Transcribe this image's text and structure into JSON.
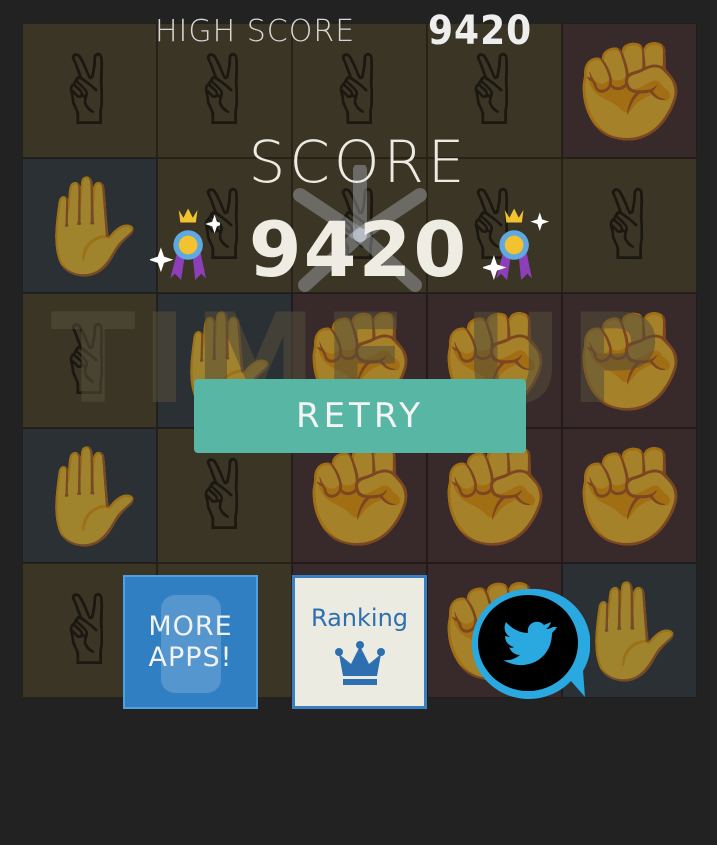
{
  "header": {
    "high_score_label": "HIGH SCORE",
    "high_score_value": "9420"
  },
  "result": {
    "score_label": "SCORE",
    "score_value": "9420",
    "time_up_label": "TIME UP"
  },
  "buttons": {
    "retry_label": "RETRY",
    "more_apps_line1": "MORE",
    "more_apps_line2": "APPS!",
    "ranking_label": "Ranking",
    "twitter_icon": "twitter-bird-icon"
  },
  "board": {
    "rows": [
      [
        "scissors",
        "scissors",
        "scissors",
        "scissors",
        "rock"
      ],
      [
        "paper",
        "scissors",
        "scissors",
        "scissors",
        "scissors"
      ],
      [
        "scissors",
        "paper",
        "rock",
        "rock",
        "rock"
      ],
      [
        "paper",
        "scissors",
        "rock",
        "rock",
        "rock"
      ],
      [
        "scissors",
        "scissors",
        "rock",
        "rock",
        "paper"
      ]
    ]
  },
  "colors": {
    "background": "#222222",
    "retry": "#58b6a4",
    "more_apps": "#2f7fc2",
    "ranking_bg": "#ecebe1",
    "twitter_ring": "#29a9e0"
  }
}
